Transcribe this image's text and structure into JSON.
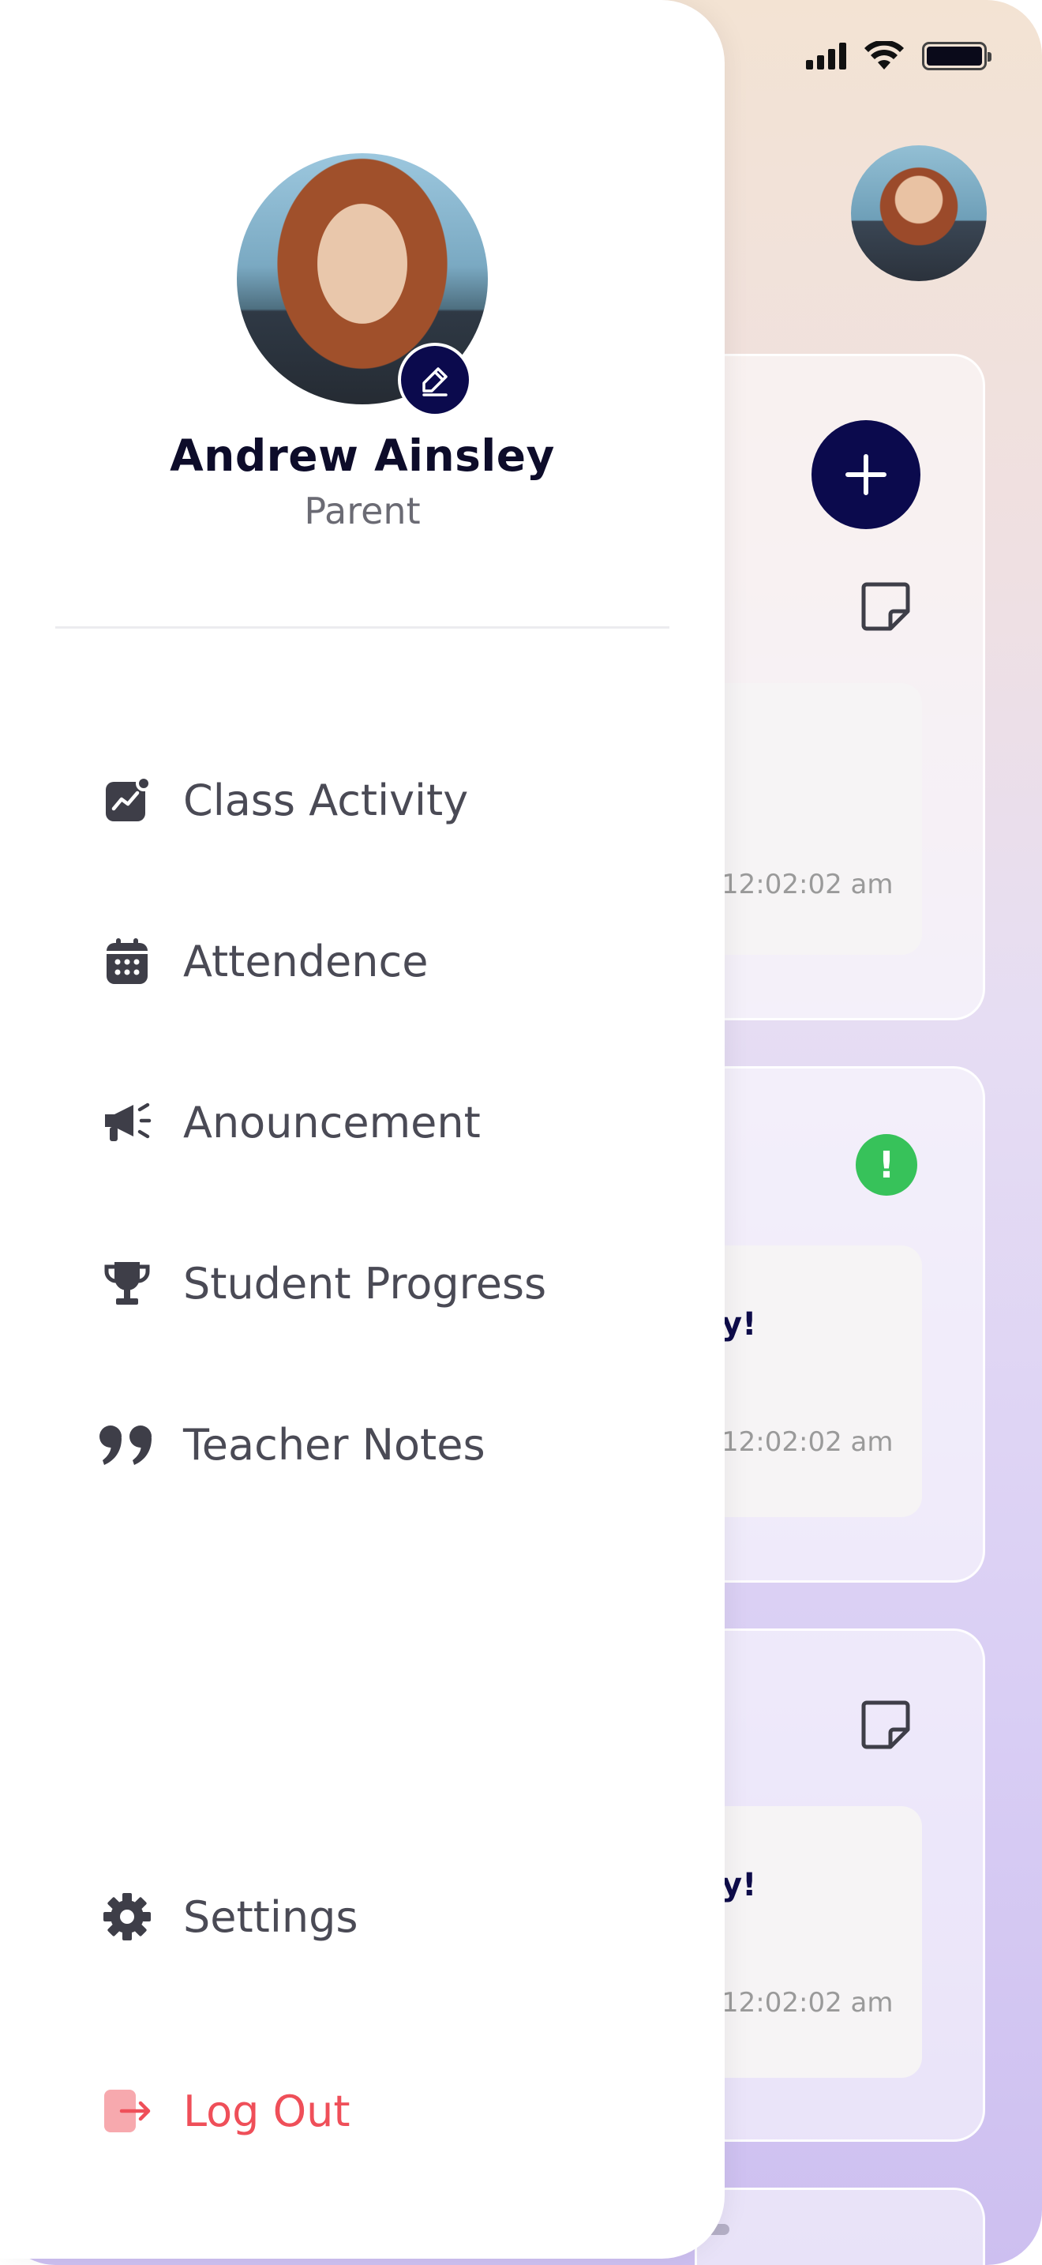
{
  "profile": {
    "name": "Andrew Ainsley",
    "role": "Parent"
  },
  "menu": {
    "items": [
      {
        "label": "Class Activity",
        "icon": "chart-activity-icon"
      },
      {
        "label": "Attendence",
        "icon": "calendar-icon"
      },
      {
        "label": "Anouncement",
        "icon": "megaphone-icon"
      },
      {
        "label": "Student Progress",
        "icon": "trophy-icon"
      },
      {
        "label": "Teacher Notes",
        "icon": "quote-icon"
      }
    ],
    "settings": {
      "label": "Settings",
      "icon": "gear-icon"
    },
    "logout": {
      "label": "Log Out",
      "icon": "logout-icon"
    }
  },
  "background": {
    "cards": [
      {
        "time": "12:02:02 am",
        "text": ""
      },
      {
        "time": "12:02:02 am",
        "text": "y!"
      },
      {
        "time": "12:02:02 am",
        "text": "y!"
      }
    ]
  },
  "colors": {
    "accent": "#0b0a4d",
    "logout": "#ef4f59",
    "success": "#37c25a",
    "text": "#4a4a55"
  }
}
